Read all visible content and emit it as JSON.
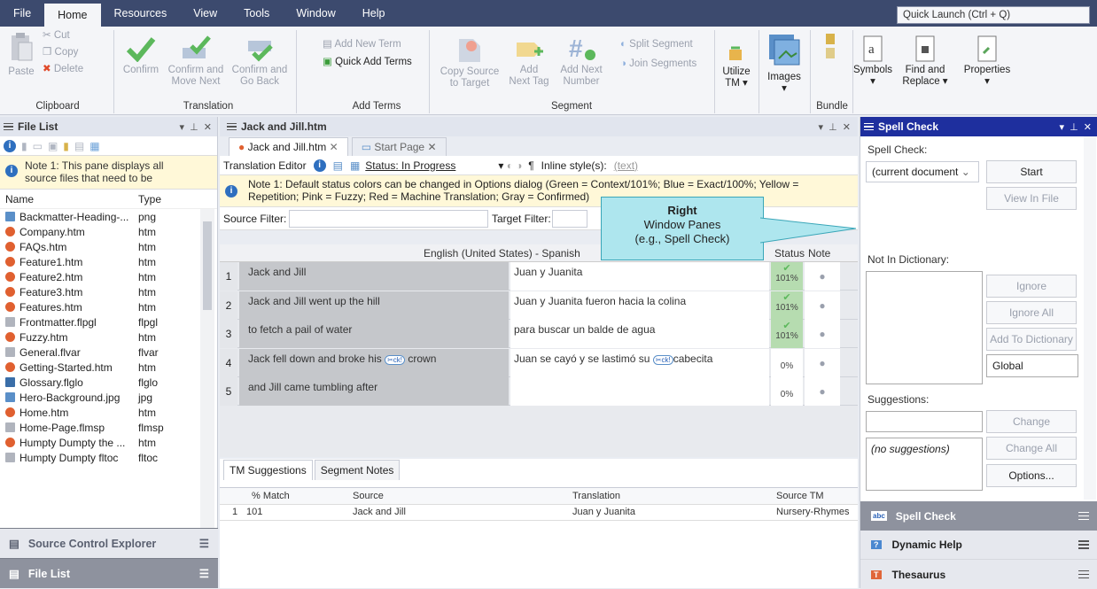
{
  "menu": {
    "items": [
      "File",
      "Home",
      "Resources",
      "View",
      "Tools",
      "Window",
      "Help"
    ],
    "quick_launch": "Quick Launch (Ctrl + Q)"
  },
  "ribbon": {
    "clipboard": {
      "paste": "Paste",
      "cut": "Cut",
      "copy": "Copy",
      "delete": "Delete",
      "label": "Clipboard"
    },
    "translation": {
      "confirm": "Confirm",
      "confirm_move_1": "Confirm and",
      "confirm_move_2": "Move Next",
      "confirm_back_1": "Confirm and",
      "confirm_back_2": "Go Back",
      "label": "Translation"
    },
    "terms": {
      "add_new": "Add New Term",
      "quick_add": "Quick Add Terms",
      "label": "Add Terms"
    },
    "segment": {
      "copy_source_1": "Copy Source",
      "copy_source_2": "to Target",
      "add_tag_1": "Add",
      "add_tag_2": "Next Tag",
      "add_number_1": "Add Next",
      "add_number_2": "Number",
      "split": "Split Segment",
      "join": "Join Segments",
      "label": "Segment"
    },
    "utilize_tm_1": "Utilize",
    "utilize_tm_2": "TM ▾",
    "images": "Images",
    "bundle": "Bundle",
    "symbols": "Symbols",
    "find_replace_1": "Find and",
    "find_replace_2": "Replace ▾",
    "properties": "Properties"
  },
  "file_list": {
    "title": "File List",
    "note": "Note 1: This pane displays all source files that need to be",
    "col_name": "Name",
    "col_type": "Type",
    "files": [
      {
        "name": "Backmatter-Heading-...",
        "type": "png"
      },
      {
        "name": "Company.htm",
        "type": "htm"
      },
      {
        "name": "FAQs.htm",
        "type": "htm"
      },
      {
        "name": "Feature1.htm",
        "type": "htm"
      },
      {
        "name": "Feature2.htm",
        "type": "htm"
      },
      {
        "name": "Feature3.htm",
        "type": "htm"
      },
      {
        "name": "Features.htm",
        "type": "htm"
      },
      {
        "name": "Frontmatter.flpgl",
        "type": "flpgl"
      },
      {
        "name": "Fuzzy.htm",
        "type": "htm"
      },
      {
        "name": "General.flvar",
        "type": "flvar"
      },
      {
        "name": "Getting-Started.htm",
        "type": "htm"
      },
      {
        "name": "Glossary.flglo",
        "type": "flglo"
      },
      {
        "name": "Hero-Background.jpg",
        "type": "jpg"
      },
      {
        "name": "Home.htm",
        "type": "htm"
      },
      {
        "name": "Home-Page.flmsp",
        "type": "flmsp"
      },
      {
        "name": "Humpty Dumpty the ...",
        "type": "htm"
      },
      {
        "name": "Humpty Dumpty fltoc",
        "type": "fltoc"
      }
    ],
    "source_control": "Source Control Explorer",
    "file_list_tab": "File List"
  },
  "editor": {
    "window_title": "Jack and Jill.htm",
    "tab_doc": "Jack and Jill.htm",
    "tab_start": "Start Page",
    "toolbar_label": "Translation Editor",
    "status": "Status: In Progress",
    "inline_style": "Inline style(s):",
    "inline_value": "(text)",
    "note": "Note 1: Default status colors can be changed in Options dialog (Green = Context/101%; Blue = Exact/100%; Yellow = Repetition; Pink = Fuzzy; Red = Machine Translation; Gray = Confirmed)",
    "source_filter": "Source Filter:",
    "target_filter": "Target Filter:",
    "lang_header": "English (United States) - Spanish",
    "col_status": "Status",
    "col_note": "Note",
    "tag": "✂ck!",
    "rows": [
      {
        "num": "1",
        "src": "Jack and Jill",
        "tgt": "Juan y Juanita",
        "pct": "101%"
      },
      {
        "num": "2",
        "src": "Jack and Jill went up the hill",
        "tgt": "Juan y Juanita fueron hacia la colina",
        "pct": "101%"
      },
      {
        "num": "3",
        "src": "to fetch a pail of water",
        "tgt": "para buscar un balde de agua",
        "pct": "101%"
      },
      {
        "num": "4",
        "src": "Jack fell down and broke his",
        "src_tail": "crown",
        "tgt": "Juan se cayó y se lastimó su",
        "tgt_tail": "cabecita",
        "pct": "0%"
      },
      {
        "num": "5",
        "src": "and Jill came tumbling after",
        "tgt": "",
        "pct": "0%"
      }
    ],
    "bottom_tabs": [
      "TM Suggestions",
      "Segment Notes"
    ],
    "tm_cols": [
      "% Match",
      "Source",
      "Translation",
      "Source TM"
    ],
    "tm_rows": [
      {
        "idx": "1",
        "match": "101",
        "source": "Jack and Jill",
        "translation": "Juan y Juanita",
        "tm": "Nursery-Rhymes"
      }
    ]
  },
  "callout": {
    "title": "Right",
    "line1": "Window Panes",
    "line2": "(e.g., Spell Check)"
  },
  "spell": {
    "title": "Spell Check",
    "label": "Spell Check:",
    "scope": "(current document",
    "start": "Start",
    "view_in_file": "View In File",
    "not_in_dict": "Not In Dictionary:",
    "ignore": "Ignore",
    "ignore_all": "Ignore All",
    "add_to_dict": "Add To Dictionary",
    "dict_scope": "Global",
    "suggestions": "Suggestions:",
    "change": "Change",
    "change_all": "Change All",
    "no_suggestions": "(no suggestions)",
    "options": "Options...",
    "tabs": [
      "Spell Check",
      "Dynamic Help",
      "Thesaurus"
    ]
  }
}
